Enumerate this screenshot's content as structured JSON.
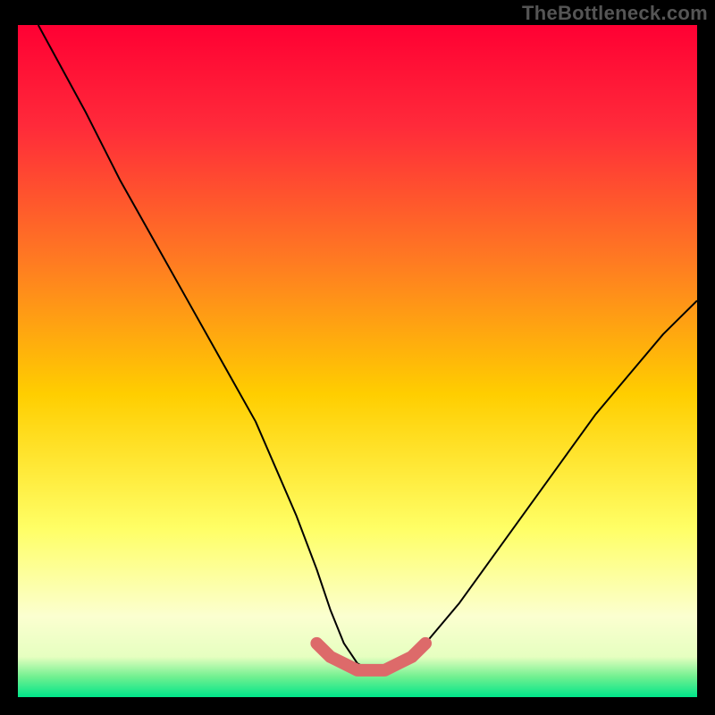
{
  "watermark": "TheBottleneck.com",
  "chart_data": {
    "type": "line",
    "title": "",
    "xlabel": "",
    "ylabel": "",
    "xlim": [
      0,
      100
    ],
    "ylim": [
      0,
      100
    ],
    "grid": false,
    "legend": false,
    "series": [
      {
        "name": "bottleneck-curve",
        "x": [
          3,
          10,
          15,
          20,
          25,
          30,
          35,
          38,
          41,
          44,
          46,
          48,
          50,
          52,
          54,
          56,
          60,
          65,
          70,
          75,
          80,
          85,
          90,
          95,
          100
        ],
        "values": [
          100,
          87,
          77,
          68,
          59,
          50,
          41,
          34,
          27,
          19,
          13,
          8,
          5,
          4,
          4,
          5,
          8,
          14,
          21,
          28,
          35,
          42,
          48,
          54,
          59
        ]
      },
      {
        "name": "optimal-zone-highlight",
        "x": [
          44,
          46,
          48,
          50,
          52,
          54,
          56,
          58,
          60
        ],
        "values": [
          8,
          6,
          5,
          4,
          4,
          4,
          5,
          6,
          8
        ]
      }
    ],
    "gradient_stops": [
      {
        "offset": 0.0,
        "color": "#ff0033"
      },
      {
        "offset": 0.15,
        "color": "#ff2a3a"
      },
      {
        "offset": 0.35,
        "color": "#ff7a22"
      },
      {
        "offset": 0.55,
        "color": "#ffce00"
      },
      {
        "offset": 0.75,
        "color": "#ffff66"
      },
      {
        "offset": 0.88,
        "color": "#fbffd0"
      },
      {
        "offset": 0.94,
        "color": "#e6ffc0"
      },
      {
        "offset": 0.97,
        "color": "#70f090"
      },
      {
        "offset": 1.0,
        "color": "#00e58a"
      }
    ],
    "colors": {
      "curve_stroke": "#000000",
      "highlight_stroke": "#dd6a6a"
    }
  }
}
